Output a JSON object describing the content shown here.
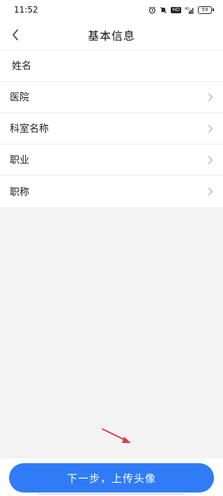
{
  "status_bar": {
    "time": "11:52",
    "hd_label": "HD",
    "network_label": "4G",
    "battery_level": "59"
  },
  "header": {
    "title": "基本信息"
  },
  "form": {
    "rows": [
      {
        "label": "姓名",
        "has_chevron": false
      },
      {
        "label": "医院",
        "has_chevron": true
      },
      {
        "label": "科室名称",
        "has_chevron": true
      },
      {
        "label": "职业",
        "has_chevron": true
      },
      {
        "label": "职称",
        "has_chevron": true
      }
    ]
  },
  "actions": {
    "next_label": "下一步，上传头像"
  },
  "colors": {
    "primary": "#2f7cf6",
    "background": "#f3f3f3",
    "annotation_arrow": "#e23a4f"
  }
}
